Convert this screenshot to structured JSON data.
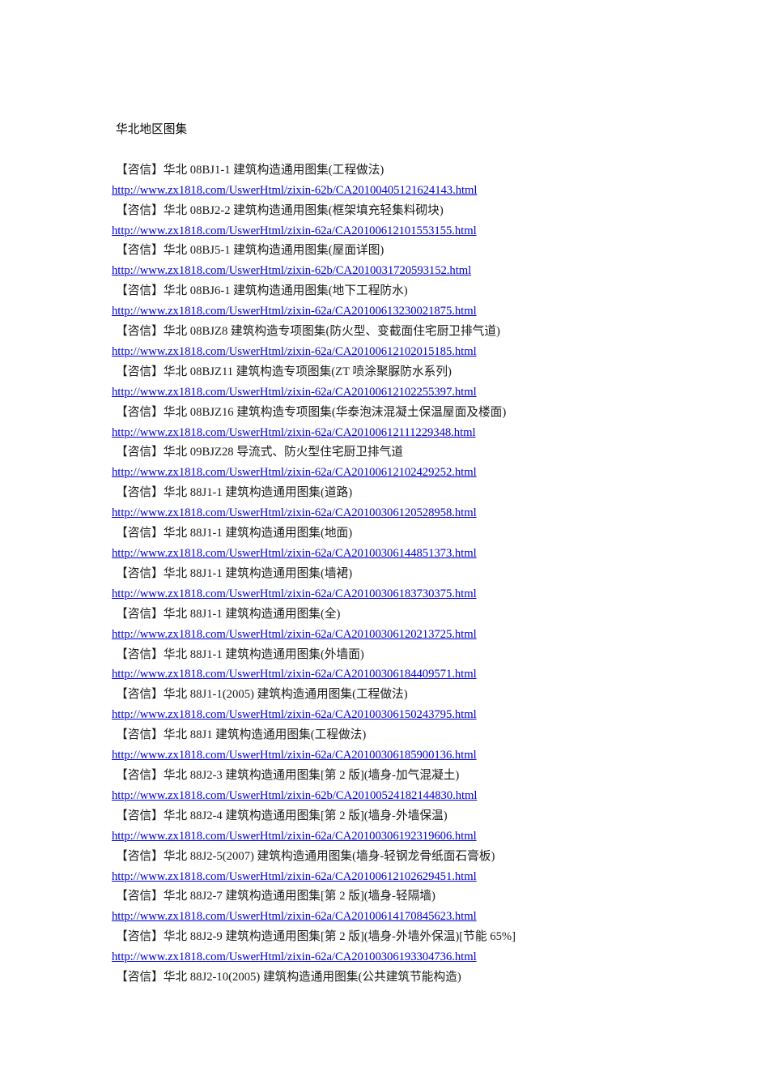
{
  "document": {
    "heading": "华北地区图集",
    "link_color": "#0000cc",
    "text_color": "#1a1a1a"
  },
  "entries": [
    {
      "title": "【咨信】华北 08BJ1-1 建筑构造通用图集(工程做法)",
      "url": "http://www.zx1818.com/UswerHtml/zixin-62b/CA20100405121624143.html"
    },
    {
      "title": "【咨信】华北 08BJ2-2 建筑构造通用图集(框架填充轻集料砌块)",
      "url": "http://www.zx1818.com/UswerHtml/zixin-62a/CA20100612101553155.html"
    },
    {
      "title": "【咨信】华北 08BJ5-1 建筑构造通用图集(屋面详图)",
      "url": "http://www.zx1818.com/UswerHtml/zixin-62b/CA2010031720593152.html"
    },
    {
      "title": "【咨信】华北 08BJ6-1 建筑构造通用图集(地下工程防水)",
      "url": "http://www.zx1818.com/UswerHtml/zixin-62a/CA20100613230021875.html"
    },
    {
      "title": "【咨信】华北 08BJZ8 建筑构造专项图集(防火型、变截面住宅厨卫排气道)",
      "url": "http://www.zx1818.com/UswerHtml/zixin-62a/CA20100612102015185.html"
    },
    {
      "title": "【咨信】华北 08BJZ11 建筑构造专项图集(ZT 喷涂聚脲防水系列)",
      "url": "http://www.zx1818.com/UswerHtml/zixin-62a/CA20100612102255397.html"
    },
    {
      "title": "【咨信】华北 08BJZ16 建筑构造专项图集(华泰泡沫混凝土保温屋面及楼面)",
      "url": "http://www.zx1818.com/UswerHtml/zixin-62a/CA20100612111229348.html"
    },
    {
      "title": "【咨信】华北 09BJZ28 导流式、防火型住宅厨卫排气道",
      "url": "http://www.zx1818.com/UswerHtml/zixin-62a/CA20100612102429252.html"
    },
    {
      "title": "【咨信】华北 88J1-1 建筑构造通用图集(道路)",
      "url": "http://www.zx1818.com/UswerHtml/zixin-62a/CA20100306120528958.html"
    },
    {
      "title": "【咨信】华北 88J1-1 建筑构造通用图集(地面)",
      "url": "http://www.zx1818.com/UswerHtml/zixin-62a/CA20100306144851373.html"
    },
    {
      "title": "【咨信】华北 88J1-1 建筑构造通用图集(墙裙)",
      "url": "http://www.zx1818.com/UswerHtml/zixin-62a/CA20100306183730375.html"
    },
    {
      "title": "【咨信】华北 88J1-1 建筑构造通用图集(全)",
      "url": "http://www.zx1818.com/UswerHtml/zixin-62a/CA20100306120213725.html"
    },
    {
      "title": "【咨信】华北 88J1-1 建筑构造通用图集(外墙面)",
      "url": "http://www.zx1818.com/UswerHtml/zixin-62a/CA20100306184409571.html"
    },
    {
      "title": "【咨信】华北 88J1-1(2005) 建筑构造通用图集(工程做法)",
      "url": "http://www.zx1818.com/UswerHtml/zixin-62a/CA20100306150243795.html"
    },
    {
      "title": "【咨信】华北 88J1 建筑构造通用图集(工程做法)",
      "url": "http://www.zx1818.com/UswerHtml/zixin-62a/CA20100306185900136.html"
    },
    {
      "title": "【咨信】华北 88J2-3 建筑构造通用图集[第 2 版](墙身-加气混凝土)",
      "url": "http://www.zx1818.com/UswerHtml/zixin-62b/CA20100524182144830.html"
    },
    {
      "title": "【咨信】华北 88J2-4 建筑构造通用图集[第 2 版](墙身-外墙保温)",
      "url": "http://www.zx1818.com/UswerHtml/zixin-62a/CA20100306192319606.html"
    },
    {
      "title": "【咨信】华北 88J2-5(2007) 建筑构造通用图集(墙身-轻钢龙骨纸面石膏板)",
      "url": "http://www.zx1818.com/UswerHtml/zixin-62a/CA20100612102629451.html"
    },
    {
      "title": "【咨信】华北 88J2-7 建筑构造通用图集[第 2 版](墙身-轻隔墙)",
      "url": "http://www.zx1818.com/UswerHtml/zixin-62a/CA20100614170845623.html"
    },
    {
      "title": "【咨信】华北 88J2-9 建筑构造通用图集[第 2 版](墙身-外墙外保温)[节能 65%]",
      "url": "http://www.zx1818.com/UswerHtml/zixin-62a/CA20100306193304736.html"
    },
    {
      "title": "【咨信】华北 88J2-10(2005) 建筑构造通用图集(公共建筑节能构造)",
      "url": null
    }
  ]
}
